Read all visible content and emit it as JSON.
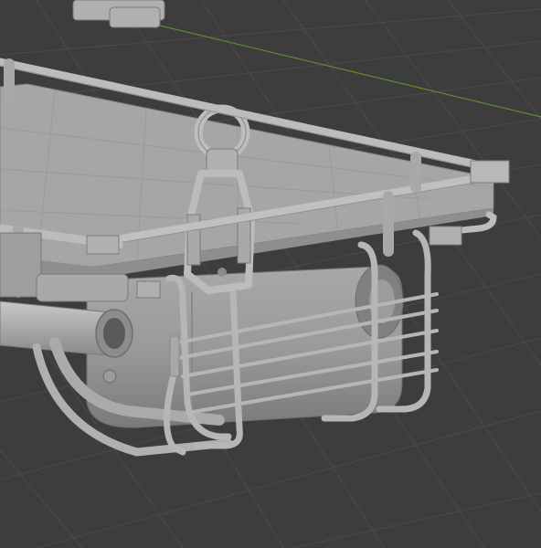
{
  "viewport": {
    "kind": "3d-viewport",
    "background_color": "#3d3d3d",
    "grid_color": "#4a4a4a",
    "axis_color": "#5e8f2a",
    "model_color": "#b4b4b4",
    "model_shadow_color": "#8c8c8c",
    "model_highlight_color": "#cfcfcf"
  },
  "scene": {
    "objects": [
      "truck-bed-platform",
      "top-guard-rail",
      "lifting-shackle",
      "fuel-tank",
      "exhaust-pipe",
      "tank-cage-guard",
      "rail-end-cap"
    ]
  }
}
